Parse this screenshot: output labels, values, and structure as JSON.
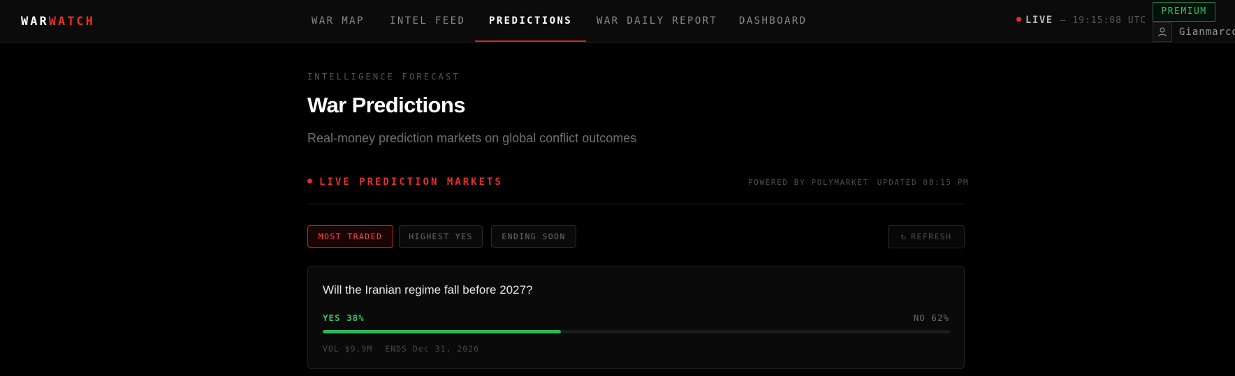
{
  "header": {
    "logo_part1": "WAR",
    "logo_part2": "WATCH",
    "tabs": [
      {
        "label": "WAR MAP",
        "active": false
      },
      {
        "label": "INTEL FEED",
        "active": false
      },
      {
        "label": "PREDICTIONS",
        "active": true
      },
      {
        "label": "WAR DAILY REPORT",
        "active": false
      },
      {
        "label": "DASHBOARD",
        "active": false
      }
    ],
    "live_label": "LIVE",
    "live_time": "— 19:15:08 UTC",
    "premium_label": "PREMIUM",
    "user_name": "Gianmarco"
  },
  "page": {
    "eyebrow": "INTELLIGENCE FORECAST",
    "title": "War Predictions",
    "subtitle": "Real-money prediction markets on global conflict outcomes"
  },
  "markets": {
    "section_title": "LIVE PREDICTION MARKETS",
    "powered_by": "POWERED BY POLYMARKET",
    "updated": "UPDATED 08:15 PM",
    "filters": [
      {
        "label": "MOST TRADED",
        "active": true
      },
      {
        "label": "HIGHEST YES",
        "active": false
      },
      {
        "label": "ENDING SOON",
        "active": false
      }
    ],
    "refresh_label": "REFRESH",
    "items": [
      {
        "question": "Will the Iranian regime fall before 2027?",
        "yes_label": "YES 38%",
        "no_label": "NO 62%",
        "yes_fraction": 0.38,
        "volume": "VOL $9.9M",
        "ends": "ENDS Dec 31, 2026"
      }
    ]
  },
  "colors": {
    "accent_red": "#e0302c",
    "yes_green": "#37c462",
    "premium_green": "#31c55c"
  },
  "icons": {
    "user": "user-icon",
    "refresh": "refresh-icon",
    "live_dot": "live-dot-icon"
  }
}
